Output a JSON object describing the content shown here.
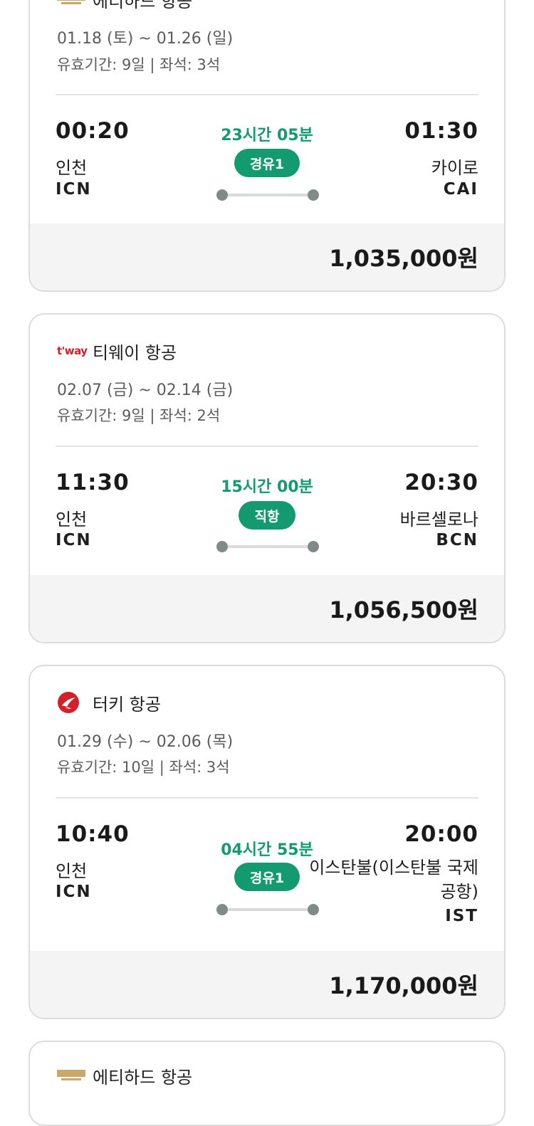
{
  "flights": [
    {
      "airline": "에티하드 항공",
      "dates": "01.18 (토) ~ 01.26 (일)",
      "validity": "유효기간: 9일 | 좌석: 3석",
      "dep_time": "00:20",
      "dep_city": "인천",
      "dep_code": "ICN",
      "duration": "23시간 05분",
      "stop": "경유1",
      "arr_time": "01:30",
      "arr_city": "카이로",
      "arr_code": "CAI",
      "price": "1,035,000원",
      "logo": "etihad-logo"
    },
    {
      "airline": "티웨이 항공",
      "dates": "02.07 (금) ~ 02.14 (금)",
      "validity": "유효기간: 9일 | 좌석: 2석",
      "dep_time": "11:30",
      "dep_city": "인천",
      "dep_code": "ICN",
      "duration": "15시간 00분",
      "stop": "직항",
      "arr_time": "20:30",
      "arr_city": "바르셀로나",
      "arr_code": "BCN",
      "price": "1,056,500원",
      "logo": "tway-logo",
      "logo_text": "t'way"
    },
    {
      "airline": "터키 항공",
      "dates": "01.29 (수) ~ 02.06 (목)",
      "validity": "유효기간: 10일 | 좌석: 3석",
      "dep_time": "10:40",
      "dep_city": "인천",
      "dep_code": "ICN",
      "duration": "04시간 55분",
      "stop": "경유1",
      "arr_time": "20:00",
      "arr_city": "이스탄불(이스탄불 국제공항)",
      "arr_code": "IST",
      "price": "1,170,000원",
      "logo": "turkish-airlines-logo"
    },
    {
      "airline": "에티하드 항공",
      "logo": "etihad-logo"
    }
  ],
  "colors": {
    "accent": "#139a6e",
    "price_bar": "#f4f4f4",
    "border": "#dcdcdc"
  }
}
